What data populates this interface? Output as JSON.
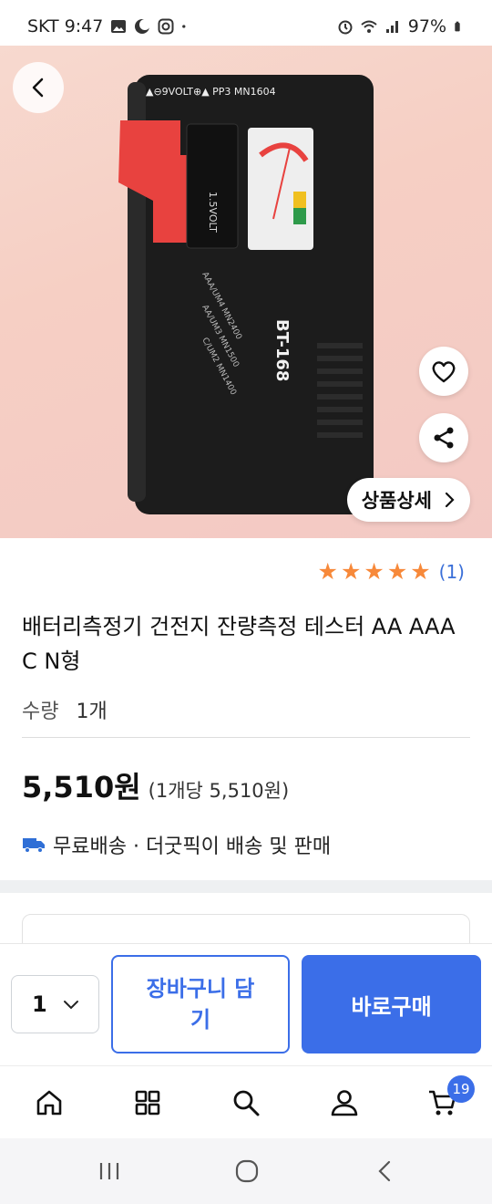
{
  "status_bar": {
    "carrier_time": "SKT 9:47",
    "battery": "97%",
    "icons": [
      "gallery-icon",
      "moon-icon",
      "instagram-icon",
      "dot-icon",
      "alarm-icon",
      "wifi-icon",
      "signal-icon",
      "battery-icon"
    ]
  },
  "hero": {
    "product_model": "BT-168",
    "actions": {
      "back": "chevron-left-icon",
      "like": "heart-icon",
      "share": "share-icon"
    },
    "detail_label": "상품상세"
  },
  "product": {
    "rating_stars": 5,
    "review_count": "(1)",
    "title": "배터리측정기 건전지 잔량측정 테스터 AA AAA C N형",
    "quantity_label": "수량",
    "quantity_value": "1개",
    "price": "5,510원",
    "unit_price": "(1개당 5,510원)",
    "shipping": "무료배송 · 더굿픽이 배송 및 판매"
  },
  "buy_bar": {
    "qty": "1",
    "cart_label": "장바구니 담기",
    "buy_label": "바로구매"
  },
  "bottom_nav": {
    "items": [
      "home-icon",
      "category-icon",
      "search-icon",
      "user-icon",
      "cart-icon"
    ],
    "cart_badge": "19"
  },
  "colors": {
    "accent": "#3b6ee8",
    "star": "#f7893a",
    "hero_bg": "#f6cfc4"
  }
}
